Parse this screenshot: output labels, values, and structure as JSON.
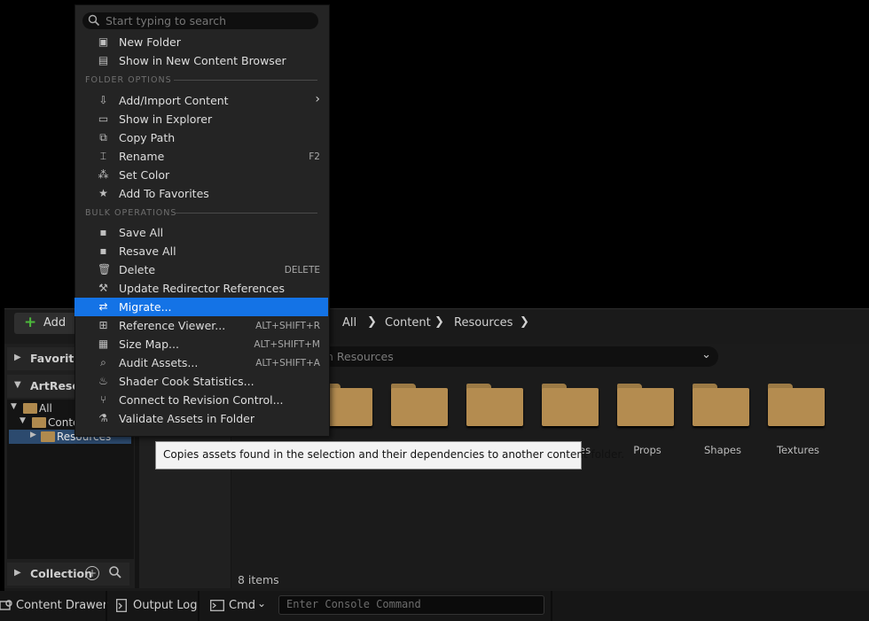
{
  "context_menu": {
    "search_placeholder": "Start typing to search",
    "items_top": [
      {
        "label": "New Folder",
        "icon": "new-folder-icon"
      },
      {
        "label": "Show in New Content Browser",
        "icon": "content-browser-icon"
      }
    ],
    "folder_options_header": "FOLDER OPTIONS",
    "folder_options": [
      {
        "label": "Add/Import Content",
        "icon": "import-icon",
        "submenu_arrow": true
      },
      {
        "label": "Show in Explorer",
        "icon": "explorer-icon"
      },
      {
        "label": "Copy Path",
        "icon": "copy-icon"
      },
      {
        "label": "Rename",
        "icon": "rename-icon",
        "shortcut": "F2"
      },
      {
        "label": "Set Color",
        "icon": "color-icon"
      },
      {
        "label": "Add To Favorites",
        "icon": "star-icon"
      }
    ],
    "bulk_operations_header": "BULK OPERATIONS",
    "bulk_operations": [
      {
        "label": "Save All",
        "icon": "save-icon"
      },
      {
        "label": "Resave All",
        "icon": "save-icon"
      },
      {
        "label": "Delete",
        "icon": "trash-icon",
        "shortcut": "DELETE"
      },
      {
        "label": "Update Redirector References",
        "icon": "wrench-icon"
      },
      {
        "label": "Migrate...",
        "icon": "migrate-icon",
        "highlighted": true
      },
      {
        "label": "Reference Viewer...",
        "icon": "reference-viewer-icon",
        "shortcut": "ALT+SHIFT+R"
      },
      {
        "label": "Size Map...",
        "icon": "size-map-icon",
        "shortcut": "ALT+SHIFT+M"
      },
      {
        "label": "Audit Assets...",
        "icon": "audit-icon",
        "shortcut": "ALT+SHIFT+A"
      },
      {
        "label": "Shader Cook Statistics...",
        "icon": "shader-icon"
      },
      {
        "label": "Connect to Revision Control...",
        "icon": "revision-control-icon"
      },
      {
        "label": "Validate Assets in Folder",
        "icon": "flask-icon"
      }
    ]
  },
  "tooltip": "Copies assets found in the selection and their dependencies to another content folder.",
  "toolbar": {
    "add_label": "Add"
  },
  "breadcrumb": [
    "All",
    "Content",
    "Resources"
  ],
  "left_pane": {
    "favorites_label": "Favorites",
    "root_label": "ArtResou",
    "tree": [
      {
        "label": "All"
      },
      {
        "label": "Conte"
      },
      {
        "label": "Resources",
        "selected": true
      }
    ],
    "collections_label": "Collection"
  },
  "search": {
    "placeholder": "h Resources"
  },
  "folders": [
    {
      "label": ""
    },
    {
      "label": ""
    },
    {
      "label": ""
    },
    {
      "label": "es"
    },
    {
      "label": "Props"
    },
    {
      "label": "Shapes"
    },
    {
      "label": "Textures"
    }
  ],
  "status": {
    "item_count": "8 items"
  },
  "bottom_bar": {
    "content_drawer": "Content Drawer",
    "output_log": "Output Log",
    "cmd": "Cmd",
    "console_placeholder": "Enter Console Command"
  },
  "colors": {
    "highlight": "#1473e6",
    "folder": "#b48c50",
    "add_plus": "#4cba3b"
  }
}
